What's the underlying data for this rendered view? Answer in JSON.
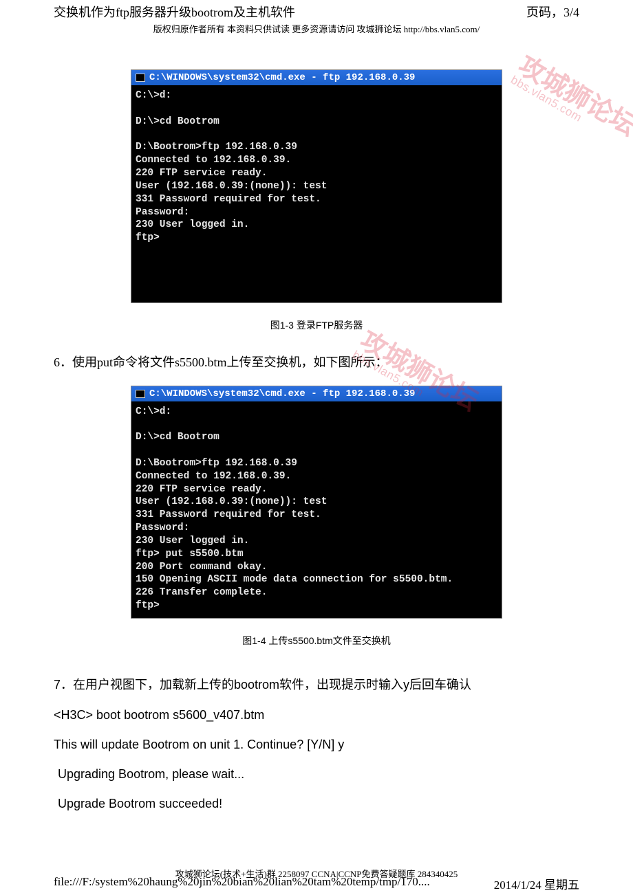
{
  "header": {
    "title": "交换机作为ftp服务器升级bootrom及主机软件",
    "page_label": "页码，3/4"
  },
  "copyright": "版权归原作者所有 本资料只供试读 更多资源请访问 攻城狮论坛 http://bbs.vlan5.com/",
  "terminal1": {
    "title": "C:\\WINDOWS\\system32\\cmd.exe - ftp 192.168.0.39",
    "body": "C:\\>d:\n\nD:\\>cd Bootrom\n\nD:\\Bootrom>ftp 192.168.0.39\nConnected to 192.168.0.39.\n220 FTP service ready.\nUser (192.168.0.39:(none)): test\n331 Password required for test.\nPassword:\n230 User logged in.\nftp>\n\n\n\n\n"
  },
  "caption1": "图1-3 登录FTP服务器",
  "step6": "6．使用put命令将文件s5500.btm上传至交换机，如下图所示：",
  "terminal2": {
    "title": "C:\\WINDOWS\\system32\\cmd.exe - ftp 192.168.0.39",
    "body": "C:\\>d:\n\nD:\\>cd Bootrom\n\nD:\\Bootrom>ftp 192.168.0.39\nConnected to 192.168.0.39.\n220 FTP service ready.\nUser (192.168.0.39:(none)): test\n331 Password required for test.\nPassword:\n230 User logged in.\nftp> put s5500.btm\n200 Port command okay.\n150 Opening ASCII mode data connection for s5500.btm.\n226 Transfer complete.\nftp>"
  },
  "caption2": "图1-4 上传s5500.btm文件至交换机",
  "step7": "7．在用户视图下，加载新上传的bootrom软件，出现提示时输入y后回车确认",
  "cmd_line": "<H3C> boot bootrom s5600_v407.btm",
  "confirm_line": "This will update Bootrom on unit 1.  Continue? [Y/N] y",
  "upgrade_wait": " Upgrading Bootrom, please wait...",
  "upgrade_done": " Upgrade Bootrom succeeded!",
  "footer_note": "攻城狮论坛(技术+生活)群 2258097 CCNA|CCNP免费答疑题库 284340425",
  "footer_path": "file:///F:/system%20haung%20jin%20bian%20lian%20tam%20temp/tmp/170....",
  "footer_date": "2014/1/24 星期五",
  "watermark": {
    "main": "攻城狮论坛",
    "sub": "bbs.vlan5.com"
  }
}
